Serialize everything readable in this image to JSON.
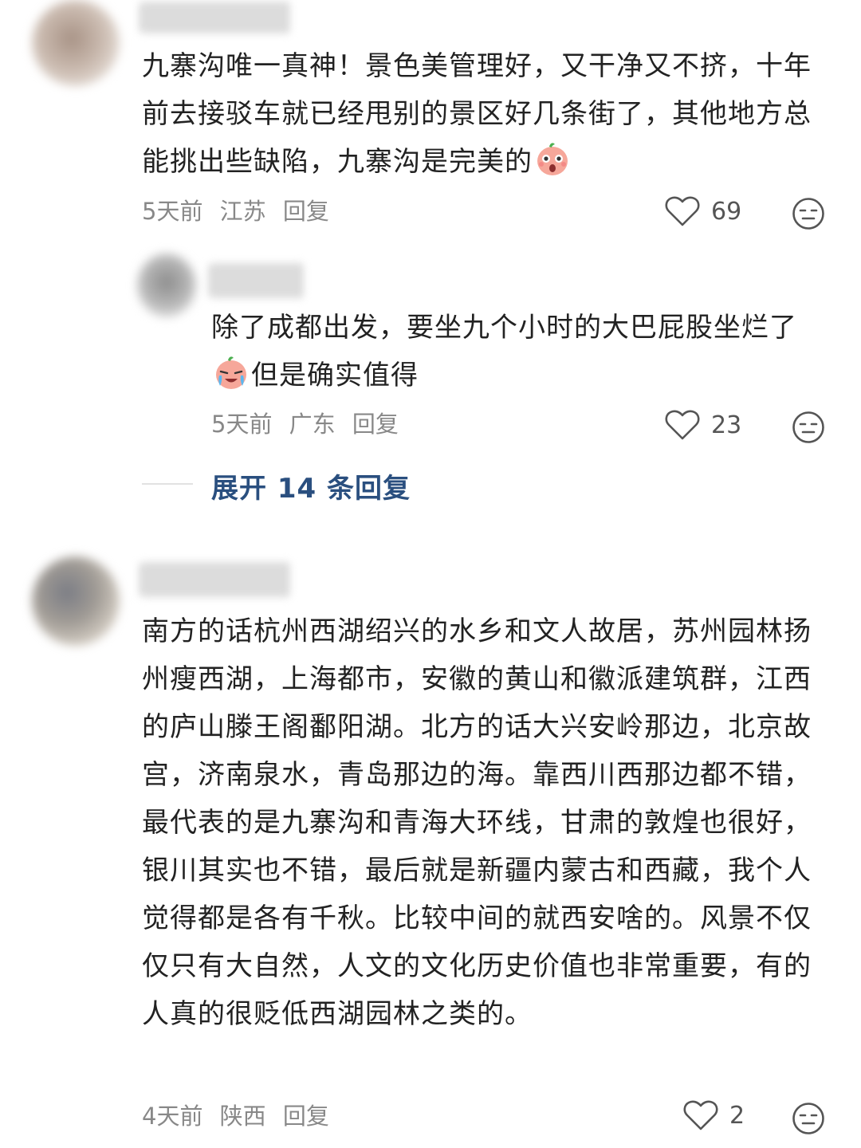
{
  "comments": [
    {
      "username": "",
      "text_parts": [
        "九寨沟唯一真神！景色美管理好，又干净又不挤，十年前去接驳车就已经甩别的景区好几条街了，其他地方总能挑出些缺陷，九寨沟是完美的",
        ""
      ],
      "emoji": "surprised-face-emoji",
      "time": "5天前",
      "location": "江苏",
      "reply_label": "回复",
      "likes": "69"
    },
    {
      "username": "",
      "text_parts": [
        "除了成都出发，要坐九个小时的大巴屁股坐烂了",
        "但是确实值得"
      ],
      "emoji": "crying-face-emoji",
      "time": "5天前",
      "location": "广东",
      "reply_label": "回复",
      "likes": "23"
    },
    {
      "username": "",
      "text_parts": [
        "南方的话杭州西湖绍兴的水乡和文人故居，苏州园林扬州瘦西湖，上海都市，安徽的黄山和徽派建筑群，江西的庐山滕王阁鄱阳湖。北方的话大兴安岭那边，北京故宫，济南泉水，青岛那边的海。靠西川西那边都不错，最代表的是九寨沟和青海大环线，甘肃的敦煌也很好，银川其实也不错，最后就是新疆内蒙古和西藏，我个人觉得都是各有千秋。比较中间的就西安啥的。风景不仅仅只有大自然，人文的文化历史价值也非常重要，有的人真的很贬低西湖园林之类的。"
      ],
      "time": "4天前",
      "location": "陕西",
      "reply_label": "回复",
      "likes": "2"
    }
  ],
  "expand_replies": {
    "label": "展开 14 条回复"
  },
  "icons": {
    "like": "heart-outline-icon",
    "dislike": "unamused-face-icon"
  },
  "colors": {
    "text": "#222222",
    "meta": "#888888",
    "link": "#2a4f7f"
  }
}
